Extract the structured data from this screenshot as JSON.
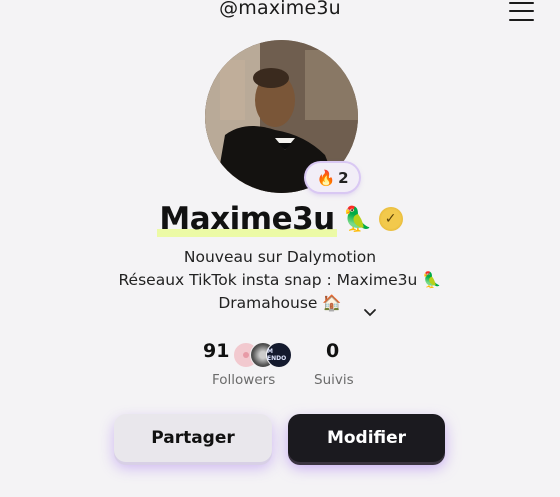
{
  "header": {
    "handle": "@maxime3u",
    "menu_icon": "hamburger-menu-icon"
  },
  "profile": {
    "avatar_icon": "profile-photo",
    "streak_emoji": "🔥",
    "streak_count": "2",
    "display_name": "Maxime3u",
    "name_emoji": "🦜",
    "verified_icon": "verified-badge-icon",
    "verified_color": "#f2c94c",
    "bio_line1": "Nouveau sur Dalymotion",
    "bio_line2": "Réseaux TikTok insta snap : Maxime3u 🦜",
    "bio_line3": "Dramahouse 🏠",
    "expand_icon": "chevron-down-icon"
  },
  "stats": {
    "followers_count": "91",
    "followers_label": "Followers",
    "follower_avatar3_text": "M ENDO",
    "following_count": "0",
    "following_label": "Suivis"
  },
  "actions": {
    "share_label": "Partager",
    "edit_label": "Modifier",
    "accent_glow": "#a06ef0"
  }
}
